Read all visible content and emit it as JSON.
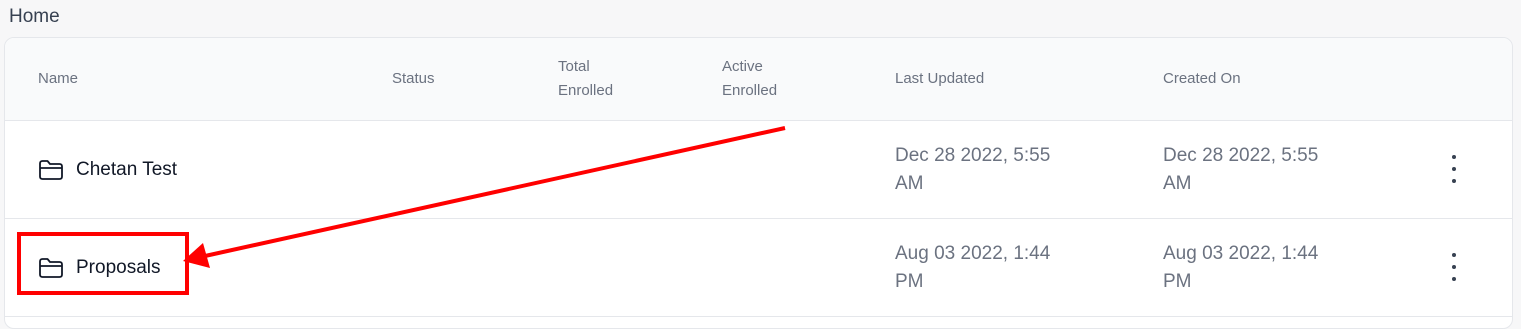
{
  "breadcrumb": "Home",
  "table": {
    "headers": {
      "name": "Name",
      "status": "Status",
      "total_enrolled_line1": "Total",
      "total_enrolled_line2": "Enrolled",
      "active_enrolled_line1": "Active",
      "active_enrolled_line2": "Enrolled",
      "last_updated": "Last Updated",
      "created_on": "Created On"
    },
    "rows": [
      {
        "name": "Chetan Test",
        "status": "",
        "total_enrolled": "",
        "active_enrolled": "",
        "last_updated_line1": "Dec 28 2022, 5:55",
        "last_updated_line2": "AM",
        "created_on_line1": "Dec 28 2022, 5:55",
        "created_on_line2": "AM",
        "icon": "folder-icon"
      },
      {
        "name": "Proposals",
        "status": "",
        "total_enrolled": "",
        "active_enrolled": "",
        "last_updated_line1": "Aug 03 2022, 1:44",
        "last_updated_line2": "PM",
        "created_on_line1": "Aug 03 2022, 1:44",
        "created_on_line2": "PM",
        "icon": "folder-icon"
      }
    ]
  },
  "colors": {
    "annotation": "#ff0000",
    "header_text": "#6b7280",
    "name_text": "#111827"
  }
}
